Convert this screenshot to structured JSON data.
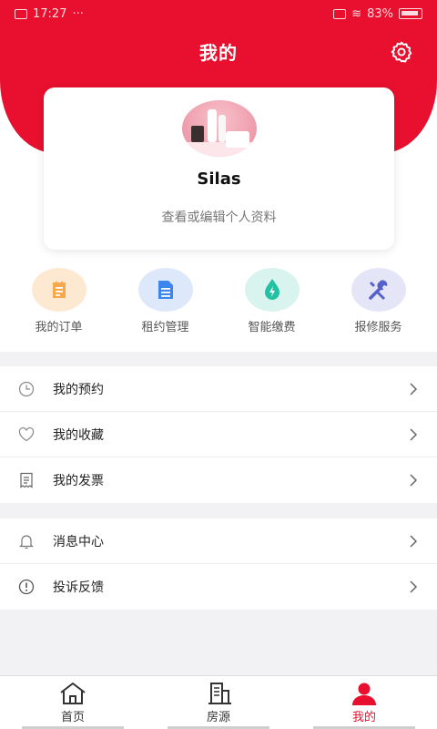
{
  "status_bar": {
    "time": "17:27",
    "battery": "83%"
  },
  "header": {
    "title": "我的"
  },
  "profile": {
    "name": "Silas",
    "edit_link": "查看或编辑个人资料"
  },
  "quick_actions": [
    {
      "label": "我的订单",
      "icon": "order-icon",
      "bg": "#fde9d2",
      "fg": "#f7a84a"
    },
    {
      "label": "租约管理",
      "icon": "document-icon",
      "bg": "#dde9fb",
      "fg": "#3d86ee"
    },
    {
      "label": "智能缴费",
      "icon": "water-drop-icon",
      "bg": "#d9f4ef",
      "fg": "#22c1a4"
    },
    {
      "label": "报修服务",
      "icon": "repair-tools-icon",
      "bg": "#e4e6f8",
      "fg": "#5661c9"
    }
  ],
  "menu_group_1": [
    {
      "label": "我的预约",
      "icon": "clock-icon"
    },
    {
      "label": "我的收藏",
      "icon": "heart-icon"
    },
    {
      "label": "我的发票",
      "icon": "receipt-icon"
    }
  ],
  "menu_group_2": [
    {
      "label": "消息中心",
      "icon": "bell-icon"
    },
    {
      "label": "投诉反馈",
      "icon": "alert-icon"
    }
  ],
  "tab_bar": [
    {
      "label": "首页",
      "icon": "home-icon"
    },
    {
      "label": "房源",
      "icon": "building-icon"
    },
    {
      "label": "我的",
      "icon": "user-icon",
      "active": true
    }
  ],
  "colors": {
    "brand": "#e8102e",
    "background": "#f2f2f4"
  }
}
